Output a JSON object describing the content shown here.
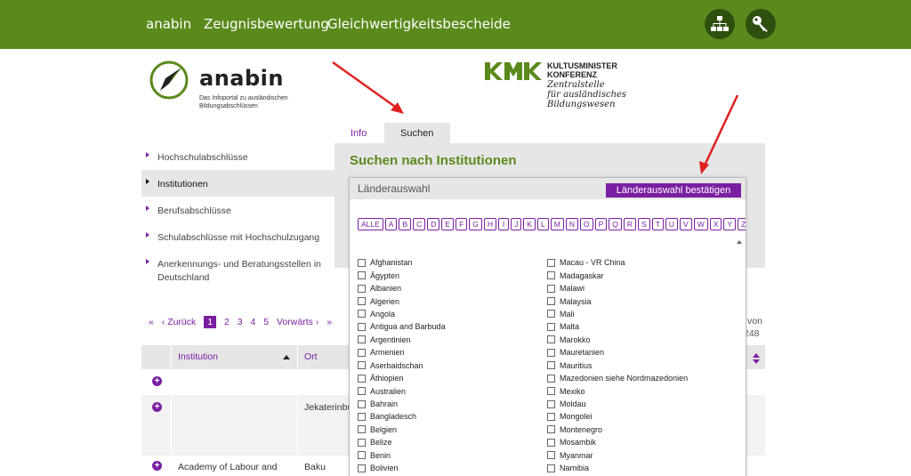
{
  "nav": {
    "links": [
      "anabin",
      "Zeugnisbewertung",
      "Gleichwertigkeitsbescheide"
    ]
  },
  "header": {
    "logo_title": "anabin",
    "logo_sub": "Das Infoportal zu ausländischen Bildungsabschlüssen",
    "kmk_line1": "KULTUSMINISTER",
    "kmk_line2": "KONFERENZ",
    "kmk_line3": "Zentralstelle",
    "kmk_line4": "für ausländisches",
    "kmk_line5": "Bildungswesen"
  },
  "tabs": [
    "Info",
    "Suchen"
  ],
  "panel_title": "Suchen nach Institutionen",
  "sidebar": {
    "items": [
      {
        "label": "Hochschulabschlüsse",
        "active": false
      },
      {
        "label": "Institutionen",
        "active": true
      },
      {
        "label": "Berufsabschlüsse",
        "active": false
      },
      {
        "label": "Schulabschlüsse mit Hochschulzugang",
        "active": false
      },
      {
        "label": "Anerkennungs- und Beratungsstellen in Deutschland",
        "active": false
      }
    ]
  },
  "pagination": {
    "first": "«",
    "prev": "‹ Zurück",
    "pages": [
      "1",
      "2",
      "3",
      "4",
      "5"
    ],
    "current": "1",
    "next": "Vorwärts ›",
    "last": "»",
    "results_line1": "von",
    "results_line2": "248"
  },
  "table": {
    "headers": [
      "Institution",
      "Ort"
    ],
    "rows": [
      {
        "institution": "",
        "ort": ""
      },
      {
        "institution": "",
        "ort": "Jekaterinbu"
      },
      {
        "institution": "Academy of Labour and",
        "ort": "Baku"
      }
    ]
  },
  "modal": {
    "title": "Länderauswahl",
    "confirm": "Länderauswahl bestätigen",
    "alphabet": [
      "ALLE",
      "A",
      "B",
      "C",
      "D",
      "E",
      "F",
      "G",
      "H",
      "I",
      "J",
      "K",
      "L",
      "M",
      "N",
      "O",
      "P",
      "Q",
      "R",
      "S",
      "T",
      "U",
      "V",
      "W",
      "X",
      "Y",
      "Z"
    ],
    "countries_left": [
      "Afghanistan",
      "Ägypten",
      "Albanien",
      "Algerien",
      "Angola",
      "Antigua and Barbuda",
      "Argentinien",
      "Armenien",
      "Aserbaidschan",
      "Äthiopien",
      "Australien",
      "Bahrain",
      "Bangladesch",
      "Belgien",
      "Belize",
      "Benin",
      "Bolivien"
    ],
    "countries_right": [
      "Macau - VR China",
      "Madagaskar",
      "Malawi",
      "Malaysia",
      "Mali",
      "Malta",
      "Marokko",
      "Mauretanien",
      "Mauritius",
      "Mazedonien siehe Nordmazedonien",
      "Mexiko",
      "Moldau",
      "Mongolei",
      "Montenegro",
      "Mosambik",
      "Myanmar",
      "Namibia"
    ]
  },
  "colors": {
    "brand_green": "#5a8a1c",
    "accent_purple": "#7b1fa2",
    "annotation_red": "#e02020"
  },
  "icons": [
    "sitemap-icon",
    "key-icon",
    "compass-logo-icon"
  ]
}
